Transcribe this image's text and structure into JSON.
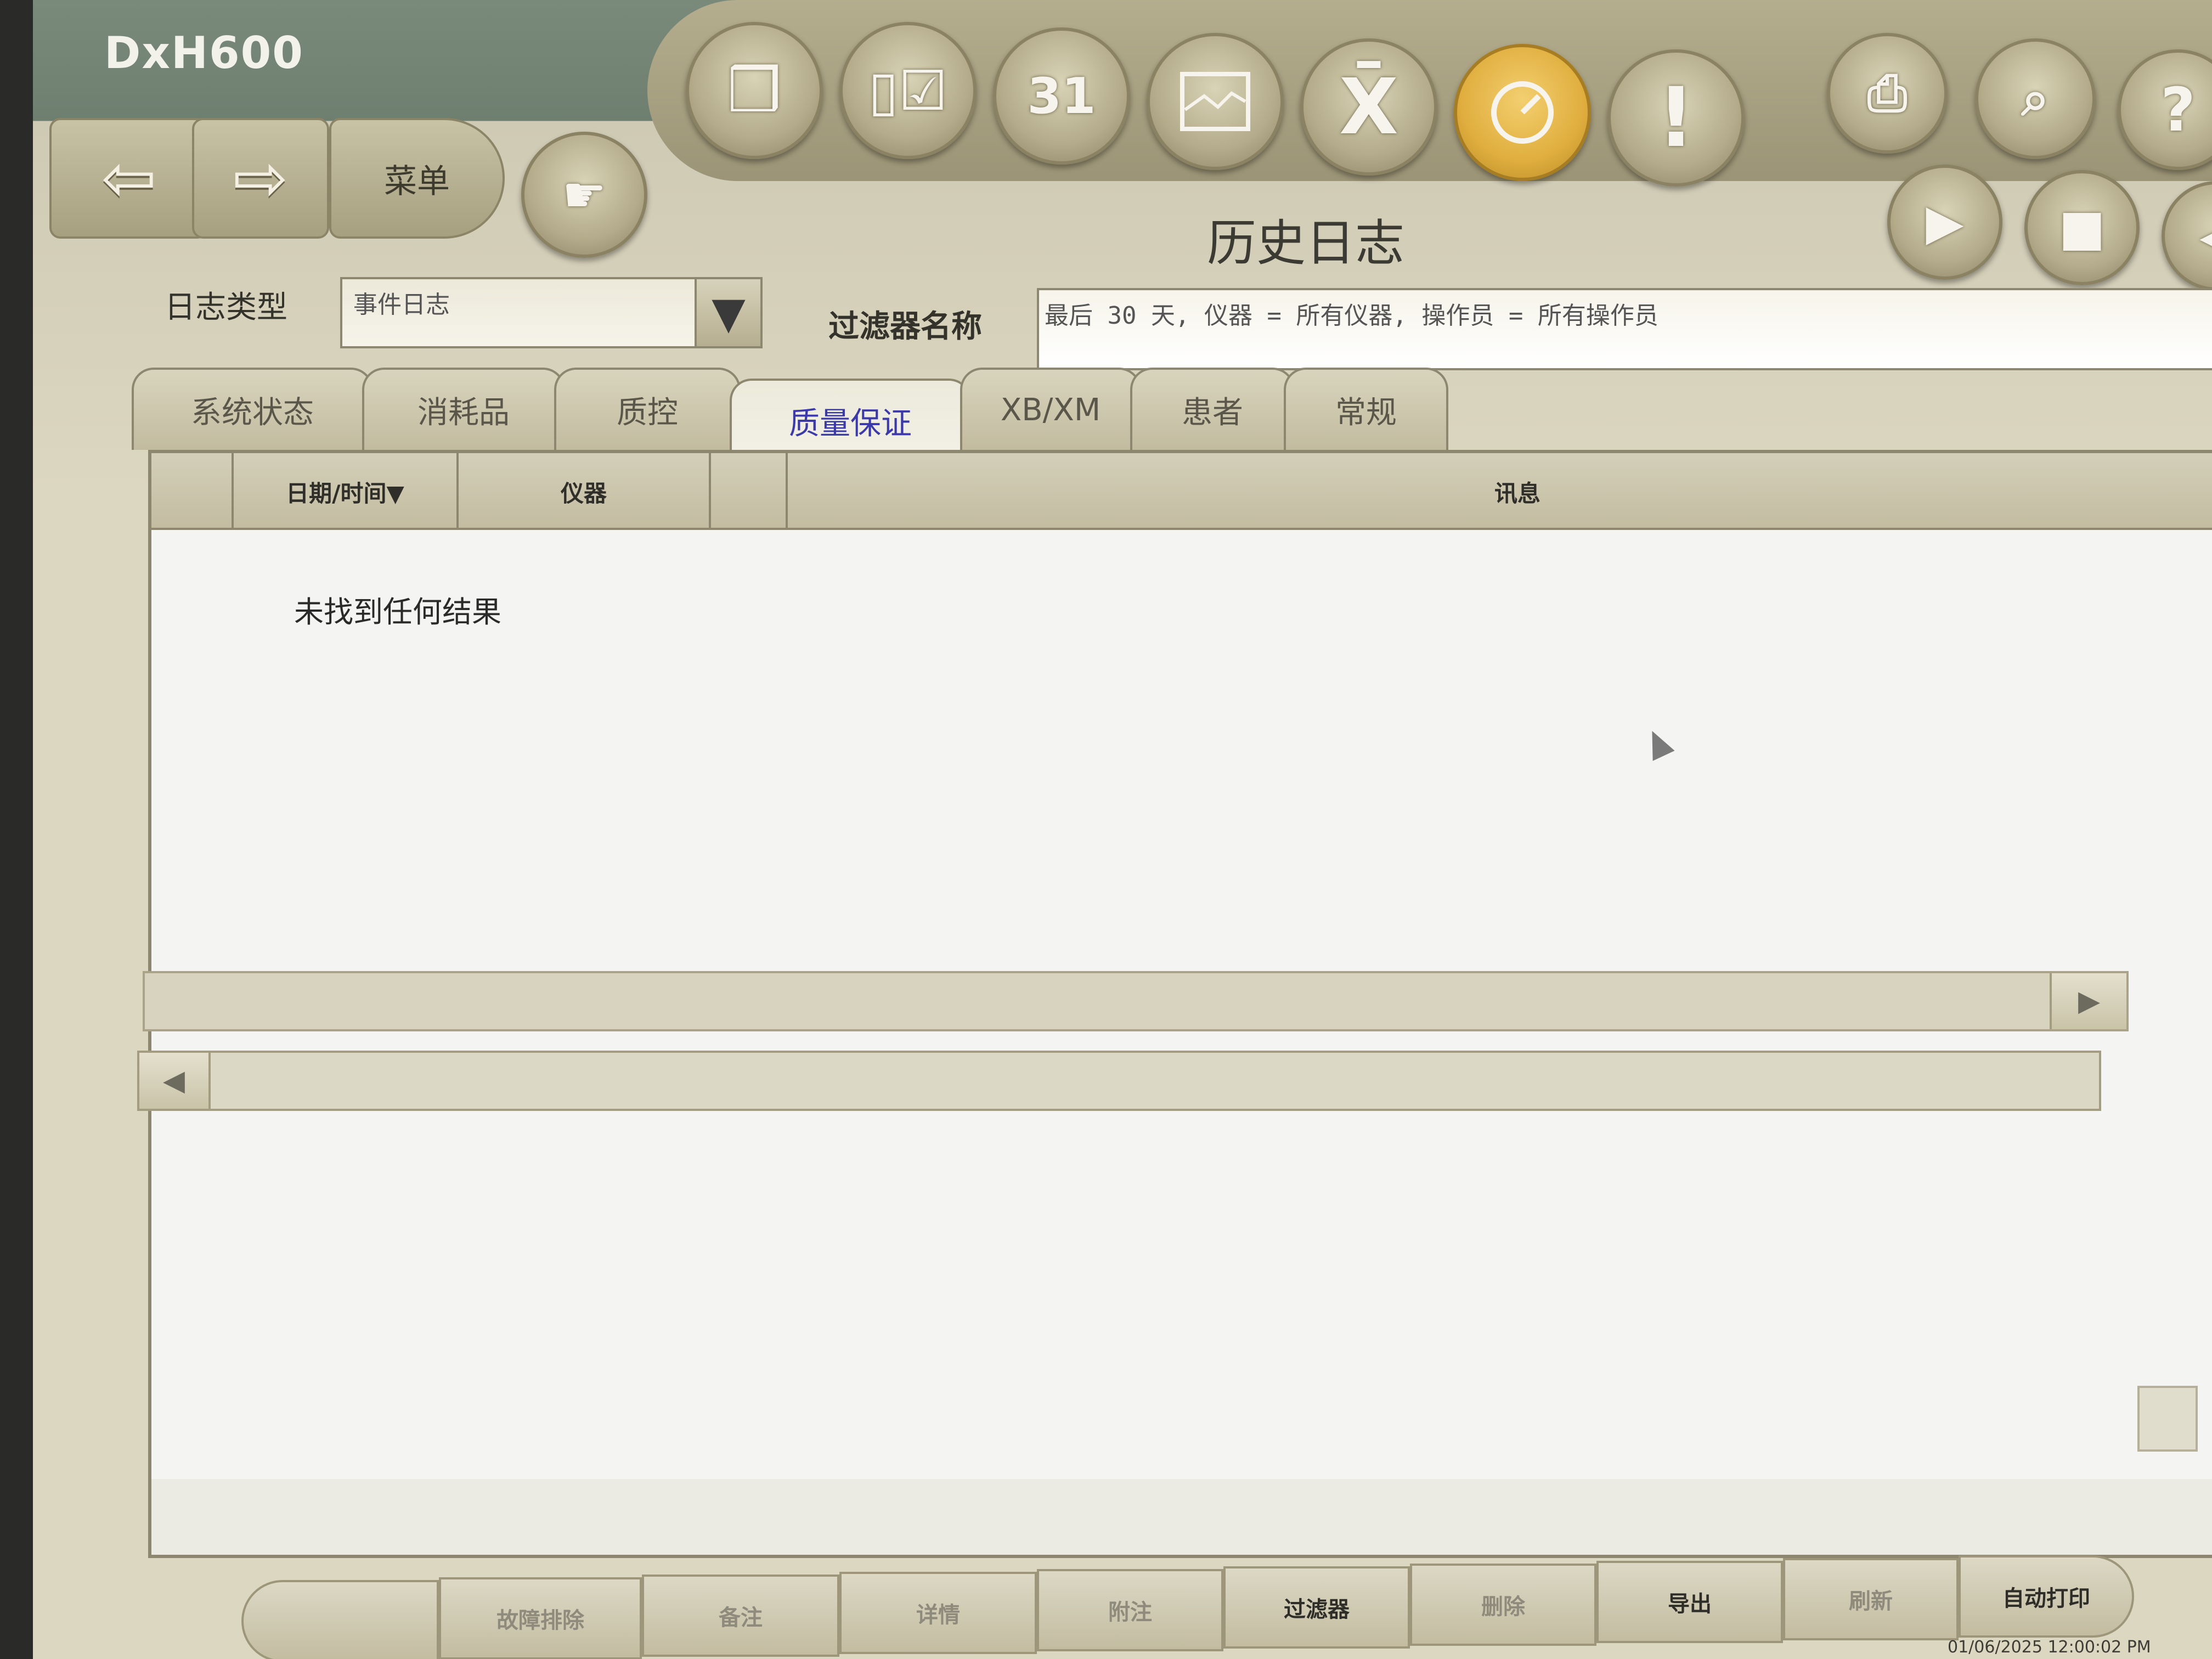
{
  "app": {
    "title": "DxH600"
  },
  "nav": {
    "back_icon": "back-arrow-icon",
    "forward_icon": "forward-arrow-icon",
    "menu_label": "菜单"
  },
  "toolbar": {
    "icons": [
      "cubes-icon",
      "tube-check-icon",
      "calendar-icon",
      "chart-icon",
      "x-bar-icon",
      "gauge-icon",
      "alert-icon",
      "print-icon",
      "search-icon",
      "help-icon",
      "play-icon",
      "stop-icon",
      "speaker-icon"
    ],
    "calendar_day": "31",
    "alert_glyph": "!",
    "help_glyph": "?",
    "active_color": "#e0ae3e"
  },
  "page": {
    "title": "历史日志"
  },
  "filters": {
    "log_type_label": "日志类型",
    "log_type_value": "事件日志",
    "filter_name_label": "过滤器名称",
    "filter_name_value": "最后 30 天, 仪器 = 所有仪器, 操作员 = 所有操作员"
  },
  "tabs": [
    {
      "label": "系统状态",
      "active": false
    },
    {
      "label": "消耗品",
      "active": false
    },
    {
      "label": "质控",
      "active": false
    },
    {
      "label": "质量保证",
      "active": true
    },
    {
      "label": "XB/XM",
      "active": false
    },
    {
      "label": "患者",
      "active": false
    },
    {
      "label": "常规",
      "active": false
    }
  ],
  "table": {
    "columns": [
      "日期/时间▼",
      "仪器",
      "",
      "讯息"
    ],
    "empty_message": "未找到任何结果"
  },
  "bottom_buttons": [
    {
      "label": "",
      "enabled": false
    },
    {
      "label": "故障排除",
      "enabled": false
    },
    {
      "label": "备注",
      "enabled": false
    },
    {
      "label": "详情",
      "enabled": false
    },
    {
      "label": "附注",
      "enabled": false
    },
    {
      "label": "过滤器",
      "enabled": true
    },
    {
      "label": "删除",
      "enabled": false
    },
    {
      "label": "导出",
      "enabled": true
    },
    {
      "label": "刷新",
      "enabled": false
    },
    {
      "label": "自动打印",
      "enabled": true
    }
  ],
  "status": {
    "datetime": "01/06/2025 12:00:02 PM"
  }
}
